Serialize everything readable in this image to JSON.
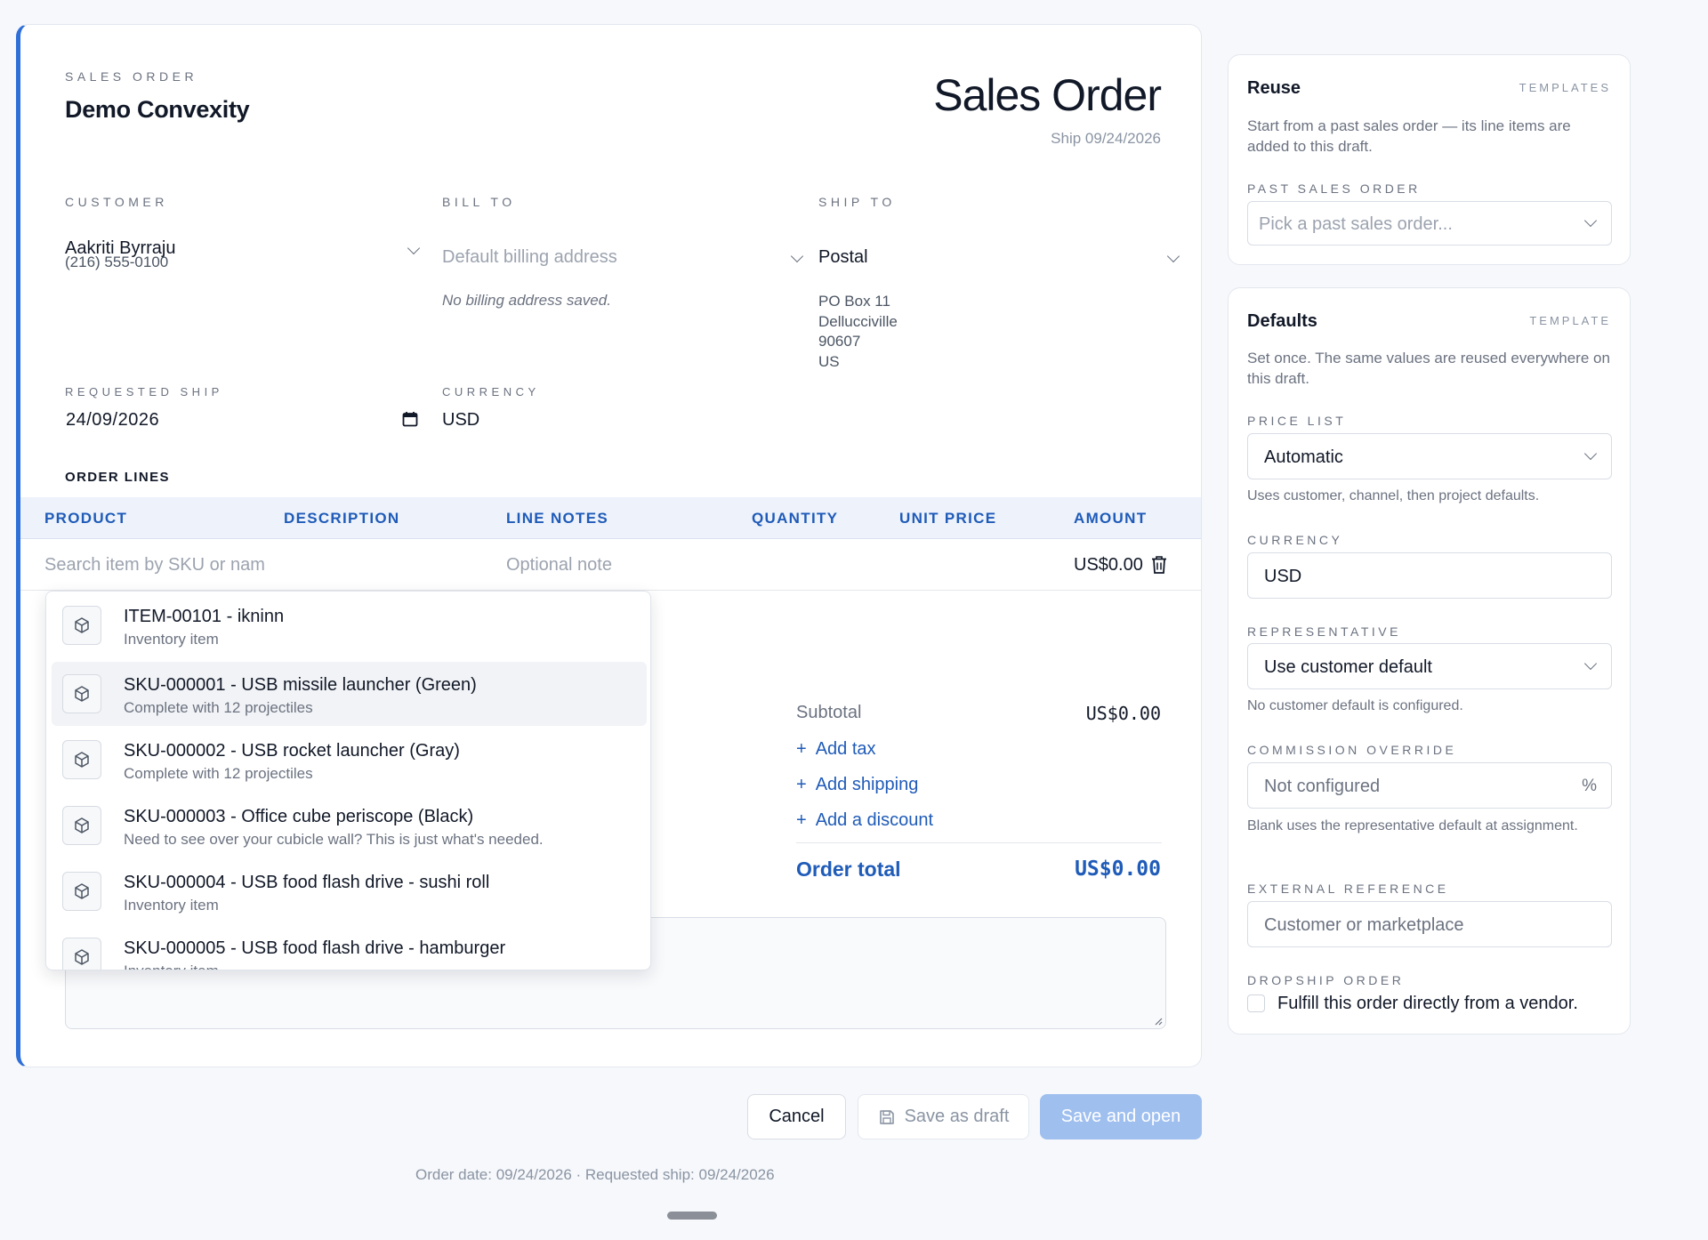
{
  "header": {
    "eyebrow": "SALES ORDER",
    "company": "Demo Convexity",
    "title": "Sales Order",
    "ship_line": "Ship 09/24/2026"
  },
  "customer": {
    "label": "CUSTOMER",
    "name": "Aakriti Byrraju",
    "phone": "(216) 555-0100"
  },
  "bill_to": {
    "label": "BILL TO",
    "placeholder": "Default billing address",
    "note": "No billing address saved."
  },
  "ship_to": {
    "label": "SHIP TO",
    "value": "Postal",
    "address": [
      "PO Box 11",
      "Dellucciville",
      "90607",
      "US"
    ]
  },
  "requested_ship": {
    "label": "REQUESTED SHIP",
    "value": "24/09/2026"
  },
  "currency_main": {
    "label": "CURRENCY",
    "value": "USD"
  },
  "order_lines": {
    "title": "ORDER LINES",
    "columns": [
      "PRODUCT",
      "DESCRIPTION",
      "LINE NOTES",
      "QUANTITY",
      "UNIT PRICE",
      "AMOUNT"
    ],
    "product_placeholder": "Search item by SKU or nam",
    "note_placeholder": "Optional note",
    "amount": "US$0.00"
  },
  "item_options": [
    {
      "title": "ITEM-00101 - ikninn",
      "subtitle": "Inventory item",
      "icon": "package-icon"
    },
    {
      "title": "SKU-000001 - USB missile launcher (Green)",
      "subtitle": "Complete with 12 projectiles",
      "icon": "package-icon"
    },
    {
      "title": "SKU-000002 - USB rocket launcher (Gray)",
      "subtitle": "Complete with 12 projectiles",
      "icon": "package-icon"
    },
    {
      "title": "SKU-000003 - Office cube periscope (Black)",
      "subtitle": "Need to see over your cubicle wall? This is just what's needed.",
      "icon": "package-icon"
    },
    {
      "title": "SKU-000004 - USB food flash drive - sushi roll",
      "subtitle": "Inventory item",
      "icon": "package-icon"
    },
    {
      "title": "SKU-000005 - USB food flash drive - hamburger",
      "subtitle": "Inventory item",
      "icon": "package-icon"
    }
  ],
  "totals": {
    "subtotal_label": "Subtotal",
    "subtotal": "US$0.00",
    "add_tax": "Add tax",
    "add_shipping": "Add shipping",
    "add_discount": "Add a discount",
    "total_label": "Order total",
    "total": "US$0.00"
  },
  "actions": {
    "cancel": "Cancel",
    "save_draft": "Save as draft",
    "save_open": "Save and open"
  },
  "footer_note": "Order date: 09/24/2026 · Requested ship: 09/24/2026",
  "reuse": {
    "title": "Reuse",
    "tag": "TEMPLATES",
    "description": "Start from a past sales order — its line items are added to this draft.",
    "past_label": "PAST SALES ORDER",
    "past_placeholder": "Pick a past sales order..."
  },
  "defaults": {
    "title": "Defaults",
    "tag": "TEMPLATE",
    "description": "Set once. The same values are reused everywhere on this draft.",
    "price_list_label": "PRICE LIST",
    "price_list_value": "Automatic",
    "price_list_hint": "Uses customer, channel, then project defaults.",
    "currency_label": "CURRENCY",
    "currency_value": "USD",
    "rep_label": "REPRESENTATIVE",
    "rep_value": "Use customer default",
    "rep_hint": "No customer default is configured.",
    "commission_label": "COMMISSION OVERRIDE",
    "commission_placeholder": "Not configured",
    "commission_suffix": "%",
    "commission_hint": "Blank uses the representative default at assignment.",
    "extref_label": "EXTERNAL REFERENCE",
    "extref_placeholder": "Customer or marketplace",
    "dropship_label": "DROPSHIP ORDER",
    "dropship_text": "Fulfill this order directly from a vendor."
  },
  "colors": {
    "accent": "#2f6fd8",
    "link": "#1f5bb8",
    "primary_disabled": "#9fbfef"
  }
}
